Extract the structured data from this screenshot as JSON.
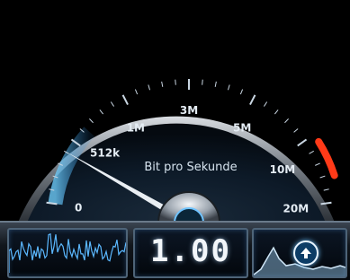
{
  "gauge": {
    "scale_labels": [
      "0",
      "512k",
      "1M",
      "3M",
      "5M",
      "10M",
      "20M"
    ],
    "unit_label": "Bit pro Sekunde",
    "needle_level": 0.21,
    "accent_color": "#2f8fe0",
    "danger_color": "#ff3a18"
  },
  "status_bar": {
    "speed_value": "1.00",
    "left_graph_icon": "signal-waveform-icon",
    "right_graph_icon": "traffic-graph-icon",
    "action_icon": "upload-arrow-icon"
  }
}
